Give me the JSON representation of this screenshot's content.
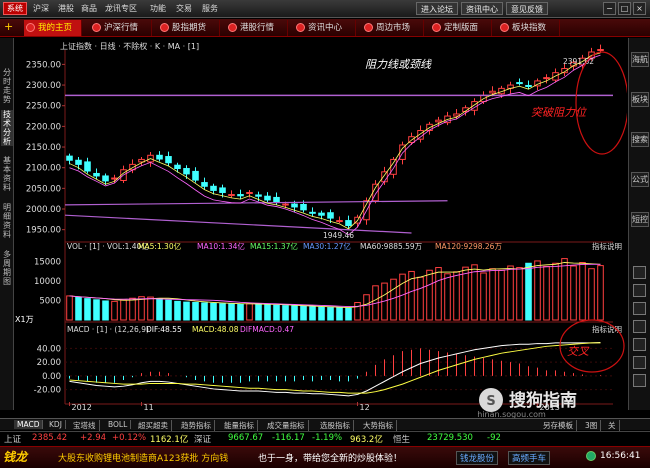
{
  "menubar": {
    "items": [
      "系统",
      "沪深",
      "港股",
      "商品",
      "龙讯专区",
      "功能",
      "交易",
      "服务"
    ],
    "active": 0,
    "right_buttons": [
      "进入论坛",
      "资讯中心",
      "意见反馈"
    ],
    "window_buttons": [
      "−",
      "□",
      "×"
    ]
  },
  "tabs": [
    {
      "label": "我的主页",
      "active": true
    },
    {
      "label": "沪深行情",
      "active": false
    },
    {
      "label": "股指期货",
      "active": false
    },
    {
      "label": "港股行情",
      "active": false
    },
    {
      "label": "资讯中心",
      "active": false
    },
    {
      "label": "周边市场",
      "active": false
    },
    {
      "label": "定制版面",
      "active": false
    },
    {
      "label": "板块指数",
      "active": false
    }
  ],
  "left_strip": [
    "分时走势",
    "技术分析",
    "基本资料",
    "明细资料",
    "多周期图"
  ],
  "right_strip": [
    "海航",
    "板块",
    "搜索",
    "公式",
    "短控"
  ],
  "chart_header": {
    "index_title": "上证指数 · 日线 · 不除权 · K · MA · [1]",
    "vol_title": "VOL · [1] · VOL:1.40亿",
    "vol_ma": [
      "MA5:1.30亿",
      "MA10:1.34亿",
      "MA15:1.37亿",
      "MA30:1.27亿",
      "MA60:9885.59万",
      "MA120:9298.26万"
    ],
    "vol_explain": "指标说明",
    "macd_title": "MACD · [1] · (12,26,9)",
    "macd_values": [
      "DIF:48.55",
      "MACD:48.08",
      "DIFMACD:0.47"
    ],
    "macd_explain": "指标说明",
    "unit_label": "X1万"
  },
  "annotations": {
    "resistance": "阻力线或颈线",
    "breakout": "突破阻力位",
    "cross": "交叉",
    "high_label": "2391.82",
    "low_label": "1949.46"
  },
  "chart_data": {
    "type": "candlestick",
    "price_axis": [
      "2350.00",
      "2300.00",
      "2250.00",
      "2200.00",
      "2150.00",
      "2100.00",
      "2050.00",
      "2000.00",
      "1950.00"
    ],
    "price_ticks": [
      2350,
      2300,
      2250,
      2200,
      2150,
      2100,
      2050,
      2000,
      1950
    ],
    "price_range": [
      1925,
      2380
    ],
    "vol_axis": [
      "15000",
      "10000",
      "5000"
    ],
    "vol_ticks": [
      15000,
      10000,
      5000
    ],
    "vol_range": [
      0,
      17500
    ],
    "macd_axis": [
      "40.00",
      "20.00",
      "0.00",
      "-20.00"
    ],
    "macd_ticks": [
      40,
      20,
      0,
      -20
    ],
    "macd_range": [
      -38,
      58
    ],
    "x_labels": [
      "2012",
      "11",
      "12",
      "2013"
    ],
    "x_label_index": [
      0,
      8,
      32,
      52
    ],
    "resistance_level": 2275,
    "high": 2391.82,
    "low": 1949.46,
    "closes": [
      2118,
      2108,
      2092,
      2080,
      2068,
      2075,
      2095,
      2108,
      2120,
      2130,
      2121,
      2112,
      2098,
      2085,
      2070,
      2055,
      2045,
      2040,
      2035,
      2032,
      2040,
      2031,
      2022,
      2018,
      2012,
      2005,
      1998,
      1990,
      1985,
      1978,
      1972,
      1960,
      1980,
      2020,
      2060,
      2090,
      2120,
      2155,
      2175,
      2190,
      2205,
      2215,
      2225,
      2230,
      2245,
      2260,
      2275,
      2285,
      2292,
      2300,
      2305,
      2298,
      2310,
      2318,
      2330,
      2340,
      2355,
      2365,
      2380,
      2386
    ],
    "volumes": [
      6200,
      5800,
      5500,
      5200,
      4900,
      4800,
      5100,
      5600,
      6000,
      5900,
      5400,
      5100,
      4800,
      4600,
      4500,
      4400,
      4300,
      4200,
      4100,
      4000,
      4200,
      4100,
      3900,
      3800,
      3700,
      3600,
      3500,
      3400,
      3300,
      3200,
      3100,
      3000,
      4500,
      6500,
      8800,
      9500,
      10500,
      11800,
      12500,
      11000,
      12800,
      13500,
      11900,
      12400,
      13600,
      14200,
      12100,
      13200,
      12800,
      13900,
      13500,
      14600,
      15200,
      13800,
      14600,
      15800,
      13900,
      14800,
      13200,
      14000
    ],
    "macd_dif": [
      -8,
      -10,
      -12,
      -14,
      -15,
      -16,
      -15,
      -13,
      -10,
      -8,
      -8,
      -9,
      -11,
      -13,
      -15,
      -17,
      -19,
      -20,
      -21,
      -22,
      -22,
      -22,
      -23,
      -24,
      -24,
      -25,
      -25,
      -26,
      -26,
      -27,
      -28,
      -29,
      -27,
      -22,
      -15,
      -8,
      -1,
      6,
      12,
      18,
      22,
      26,
      29,
      32,
      35,
      38,
      40,
      42,
      44,
      45,
      46,
      46,
      47,
      47,
      48,
      48,
      48,
      48,
      48,
      48.55
    ],
    "macd_dea": [
      -6,
      -7,
      -8,
      -9,
      -10,
      -11,
      -12,
      -12,
      -12,
      -11,
      -11,
      -11,
      -11,
      -12,
      -12,
      -13,
      -14,
      -15,
      -16,
      -17,
      -18,
      -18,
      -19,
      -20,
      -20,
      -21,
      -22,
      -22,
      -23,
      -24,
      -24,
      -25,
      -25,
      -25,
      -23,
      -20,
      -16,
      -12,
      -7,
      -2,
      3,
      8,
      12,
      16,
      20,
      24,
      27,
      30,
      33,
      35,
      37,
      39,
      41,
      43,
      44,
      45,
      46,
      47,
      48,
      48.08
    ]
  },
  "bottom_tabs": [
    "MACD",
    "KDJ",
    "宝塔线",
    "BOLL",
    "超买超卖",
    "趋势指标",
    "能量指标",
    "成交量指标",
    "选股指标",
    "大势指标"
  ],
  "bottom_right": [
    "另存模板",
    "3图",
    "关"
  ],
  "ticker": [
    {
      "text": "上证",
      "color": "#ccc"
    },
    {
      "text": "2385.42",
      "color": "#ff4040"
    },
    {
      "text": "+2.94",
      "color": "#ff4040"
    },
    {
      "text": "+0.12%",
      "color": "#ff4040"
    },
    {
      "text": "1162.1亿",
      "color": "#ffff66"
    },
    {
      "text": "深证",
      "color": "#ccc"
    },
    {
      "text": "9667.67",
      "color": "#40ff40"
    },
    {
      "text": "-116.17",
      "color": "#40ff40"
    },
    {
      "text": "-1.19%",
      "color": "#40ff40"
    },
    {
      "text": "963.2亿",
      "color": "#ffff66"
    },
    {
      "text": "恒生",
      "color": "#ccc"
    },
    {
      "text": "23729.530",
      "color": "#40ff40"
    },
    {
      "text": "-92",
      "color": "#40ff40"
    }
  ],
  "news": {
    "logo": "钱龙",
    "headline": "大股东收购锂电池制造商A123获批  方向钱",
    "headline2": "也于一身，带给您全新的炒股体验！",
    "buttons": [
      "钱龙股份",
      "高频手车"
    ],
    "time": "16:56:41"
  },
  "watermark": {
    "text": "搜狗指南",
    "sub": "zhinan.sogou.com"
  }
}
